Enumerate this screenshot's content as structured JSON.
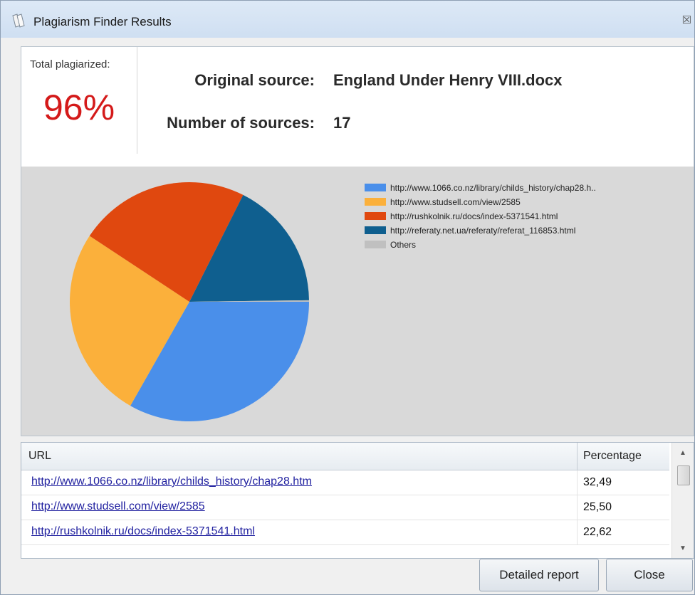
{
  "window": {
    "title": "Plagiarism Finder Results",
    "close_glyph": "☒",
    "icon": "document-icon"
  },
  "summary": {
    "total_label": "Total plagiarized:",
    "total_value": "96%",
    "total_color": "#d41a1a",
    "original_source_label": "Original source:",
    "original_source_value": "England Under Henry VIII.docx",
    "number_of_sources_label": "Number of sources:",
    "number_of_sources_value": "17"
  },
  "chart_data": {
    "type": "pie",
    "title": "",
    "series": [
      {
        "name": "http://www.1066.co.nz/library/childs_history/chap28.h..",
        "value": 32.49,
        "color": "#4a8fea"
      },
      {
        "name": "http://www.studsell.com/view/2585",
        "value": 25.5,
        "color": "#fbb03b"
      },
      {
        "name": "http://rushkolnik.ru/docs/index-5371541.html",
        "value": 22.62,
        "color": "#e0480f"
      },
      {
        "name": "http://referaty.net.ua/referaty/referat_116853.html",
        "value": 17.0,
        "color": "#0f5f8f"
      },
      {
        "name": "Others",
        "value": 0.2,
        "color": "#c0c0c0"
      }
    ],
    "legend_position": "top-right"
  },
  "table": {
    "headers": {
      "url": "URL",
      "percentage": "Percentage"
    },
    "rows": [
      {
        "url": "http://www.1066.co.nz/library/childs_history/chap28.htm",
        "percentage": "32,49"
      },
      {
        "url": "http://www.studsell.com/view/2585",
        "percentage": "25,50"
      },
      {
        "url": "http://rushkolnik.ru/docs/index-5371541.html",
        "percentage": "22,62"
      }
    ]
  },
  "buttons": {
    "detailed_report": "Detailed report",
    "close": "Close"
  }
}
